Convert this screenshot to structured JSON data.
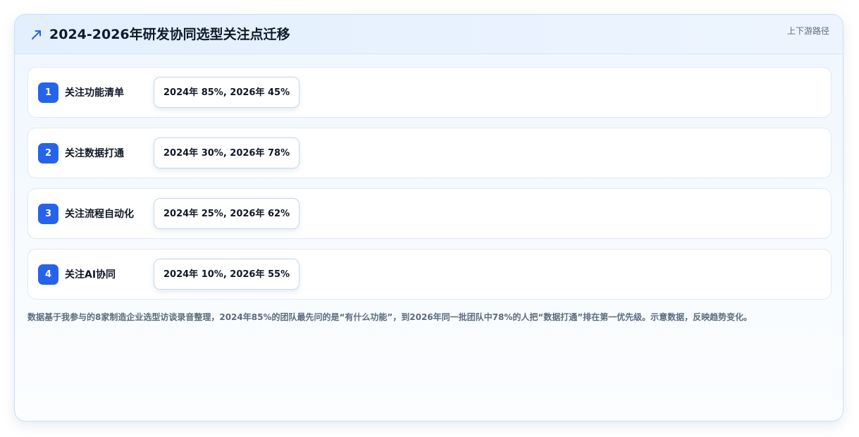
{
  "card": {
    "title": "2024-2026年研发协同选型关注点迁移",
    "tag": "上下游路径",
    "icon": "trend-up-icon"
  },
  "items": [
    {
      "number": "1",
      "label": "关注功能清单",
      "value": "2024年 85%, 2026年 45%"
    },
    {
      "number": "2",
      "label": "关注数据打通",
      "value": "2024年 30%, 2026年 78%"
    },
    {
      "number": "3",
      "label": "关注流程自动化",
      "value": "2024年 25%, 2026年 62%"
    },
    {
      "number": "4",
      "label": "关注AI协同",
      "value": "2024年 10%, 2026年 55%"
    }
  ],
  "footnote": "数据基于我参与的8家制造企业选型访谈录音整理，2024年85%的团队最先问的是“有什么功能”，到2026年同一批团队中78%的人把“数据打通”排在第一优先级。示意数据，反映趋势变化。",
  "colors": {
    "accent": "#2563eb",
    "title": "#0f1b2d",
    "muted": "#5c6b7f"
  }
}
